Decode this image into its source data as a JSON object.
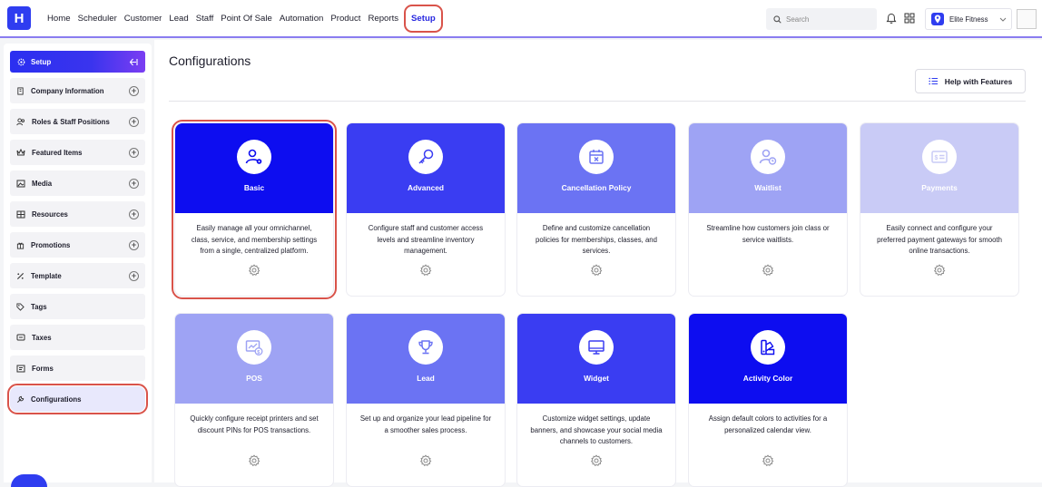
{
  "header": {
    "logo": "H",
    "nav": [
      "Home",
      "Scheduler",
      "Customer",
      "Lead",
      "Staff",
      "Point Of Sale",
      "Automation",
      "Product",
      "Reports",
      "Setup"
    ],
    "search_placeholder": "Search",
    "location": "Elite Fitness"
  },
  "sidebar": {
    "title": "Setup",
    "items": [
      {
        "label": "Company Information",
        "icon": "building-icon",
        "expandable": true
      },
      {
        "label": "Roles & Staff Positions",
        "icon": "users-icon",
        "expandable": true
      },
      {
        "label": "Featured Items",
        "icon": "crown-icon",
        "expandable": true
      },
      {
        "label": "Media",
        "icon": "media-icon",
        "expandable": true
      },
      {
        "label": "Resources",
        "icon": "resources-icon",
        "expandable": true
      },
      {
        "label": "Promotions",
        "icon": "gift-icon",
        "expandable": true
      },
      {
        "label": "Template",
        "icon": "template-icon",
        "expandable": true
      },
      {
        "label": "Tags",
        "icon": "tag-icon",
        "expandable": false
      },
      {
        "label": "Taxes",
        "icon": "taxes-icon",
        "expandable": false
      },
      {
        "label": "Forms",
        "icon": "forms-icon",
        "expandable": false
      },
      {
        "label": "Configurations",
        "icon": "wrench-icon",
        "expandable": false
      }
    ]
  },
  "main": {
    "title": "Configurations",
    "help_button": "Help with Features",
    "cards": [
      {
        "title": "Basic",
        "desc": "Easily manage all your omnichannel, class, service, and membership settings from a single, centralized platform.",
        "color": "#0d0df0",
        "icon": "user-gear-icon"
      },
      {
        "title": "Advanced",
        "desc": "Configure staff and customer access levels and streamline inventory management.",
        "color": "#3a3df2",
        "icon": "key-icon"
      },
      {
        "title": "Cancellation Policy",
        "desc": "Define and customize cancellation policies for memberships, classes, and services.",
        "color": "#6b73f3",
        "icon": "calendar-x-icon"
      },
      {
        "title": "Waitlist",
        "desc": "Streamline how customers join class or service waitlists.",
        "color": "#9ea3f4",
        "icon": "user-clock-icon"
      },
      {
        "title": "Payments",
        "desc": "Easily connect and configure your preferred payment gateways for smooth online transactions.",
        "color": "#c9cbf6",
        "icon": "payment-icon"
      },
      {
        "title": "POS",
        "desc": "Quickly configure receipt printers and set discount PINs for POS transactions.",
        "color": "#9ea3f4",
        "icon": "pos-chart-icon"
      },
      {
        "title": "Lead",
        "desc": "Set up and organize your lead pipeline for a smoother sales process.",
        "color": "#6b73f3",
        "icon": "trophy-icon"
      },
      {
        "title": "Widget",
        "desc": "Customize widget settings, update banners, and showcase your social media channels to customers.",
        "color": "#3a3df2",
        "icon": "monitor-icon"
      },
      {
        "title": "Activity Color",
        "desc": "Assign default colors to activities for a personalized calendar view.",
        "color": "#0d0df0",
        "icon": "palette-icon"
      }
    ]
  }
}
